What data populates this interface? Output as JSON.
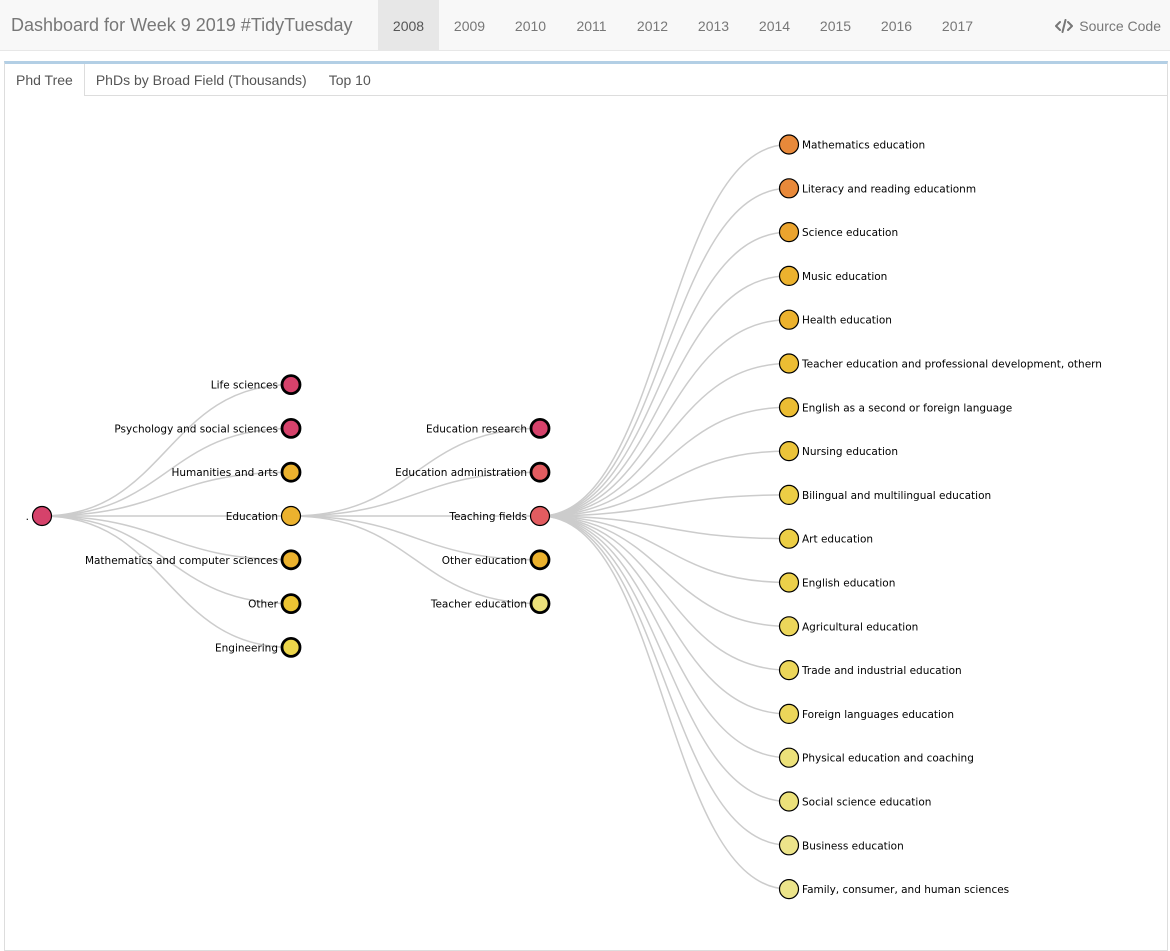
{
  "navbar": {
    "title": "Dashboard for Week 9 2019 #TidyTuesday",
    "years": [
      "2008",
      "2009",
      "2010",
      "2011",
      "2012",
      "2013",
      "2014",
      "2015",
      "2016",
      "2017"
    ],
    "active_year": "2008",
    "source_label": "Source Code",
    "source_icon": "code-icon"
  },
  "tabs": [
    "Phd Tree",
    "PhDs by Broad Field (Thousands)",
    "Top 10"
  ],
  "active_tab": "Phd Tree",
  "tree": {
    "root": {
      "label": ".",
      "color": "#d6426b"
    },
    "fields": [
      {
        "label": "Life sciences",
        "color": "#d6426b"
      },
      {
        "label": "Psychology and social sciences",
        "color": "#d6426b"
      },
      {
        "label": "Humanities and arts",
        "color": "#ecb22e"
      },
      {
        "label": "Education",
        "color": "#ecb22e",
        "expanded": true
      },
      {
        "label": "Mathematics and computer sciences",
        "color": "#ecb22e"
      },
      {
        "label": "Other",
        "color": "#ecc433"
      },
      {
        "label": "Engineering",
        "color": "#ecd54a"
      }
    ],
    "major_fields": [
      {
        "label": "Education research",
        "color": "#d6426b"
      },
      {
        "label": "Education administration",
        "color": "#e25c60"
      },
      {
        "label": "Teaching fields",
        "color": "#e25c60",
        "expanded": true
      },
      {
        "label": "Other education",
        "color": "#ecb22e"
      },
      {
        "label": "Teacher education",
        "color": "#ece17a"
      }
    ],
    "subfields": [
      {
        "label": "Mathematics education",
        "color": "#e8893a"
      },
      {
        "label": "Literacy and reading educationm",
        "color": "#e8893a"
      },
      {
        "label": "Science education",
        "color": "#eba42e"
      },
      {
        "label": "Music education",
        "color": "#ecb22e"
      },
      {
        "label": "Health education",
        "color": "#ecb22e"
      },
      {
        "label": "Teacher education and professional development, othern",
        "color": "#ecbd33"
      },
      {
        "label": "English as a second or foreign language",
        "color": "#ecbd33"
      },
      {
        "label": "Nursing education",
        "color": "#ecc43a"
      },
      {
        "label": "Bilingual and multilingual education",
        "color": "#ecce45"
      },
      {
        "label": "Art education",
        "color": "#ecce45"
      },
      {
        "label": "English education",
        "color": "#ecd04a"
      },
      {
        "label": "Agricultural education",
        "color": "#ecd65a"
      },
      {
        "label": "Trade and industrial education",
        "color": "#ecd65a"
      },
      {
        "label": "Foreign languages education",
        "color": "#ecd65a"
      },
      {
        "label": "Physical education and coaching",
        "color": "#ece17a"
      },
      {
        "label": "Social science education",
        "color": "#ece17a"
      },
      {
        "label": "Business education",
        "color": "#ece48a"
      },
      {
        "label": "Family, consumer, and human sciences",
        "color": "#ece48a"
      }
    ]
  }
}
